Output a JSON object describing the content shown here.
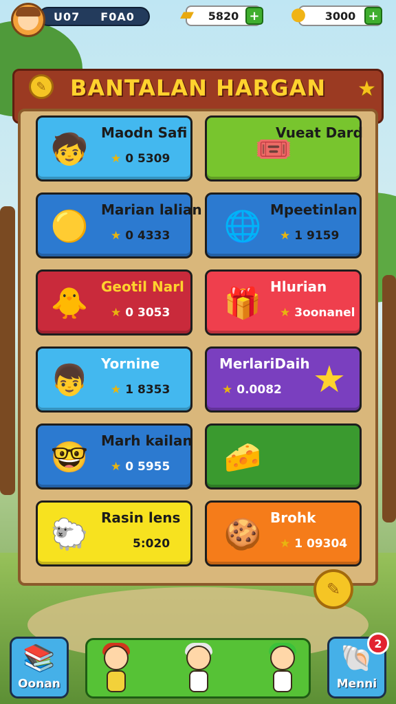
{
  "topbar": {
    "player_name": "U07",
    "player_id": "F0A0",
    "gold_bars": "5820",
    "coins": "3000",
    "plus_label": "+"
  },
  "board": {
    "title": "BANTALAN HARGAN",
    "cards": [
      {
        "name": "Maodn Safi",
        "amount": "0 5309",
        "color": "#43b8ef",
        "icon": "boy-face-icon"
      },
      {
        "name": "Vueat Dard",
        "amount": "",
        "color": "#78c52e",
        "icon": "crossed-tickets-icon"
      },
      {
        "name": "Marian lalian",
        "amount": "0 4333",
        "color": "#2c7ad0",
        "icon": "yellow-blob-icon"
      },
      {
        "name": "Mpeetinlan",
        "amount": "1 9159",
        "color": "#2c7ad0",
        "icon": "globe-ticket-icon"
      },
      {
        "name": "Geotil Narl",
        "amount": "0 3053",
        "color": "#c92a3b",
        "icon": "yellow-chick-icon"
      },
      {
        "name": "Hlurian",
        "amount": "3oonanel",
        "color": "#ef3f4d",
        "icon": "gift-box-icon"
      },
      {
        "name": "Yornine",
        "amount": "1 8353",
        "color": "#43b8ef",
        "icon": "smiling-boy-icon"
      },
      {
        "name": "MerlariDaih",
        "amount": "0.0082",
        "color": "#7a3fbf",
        "icon": "star-face-icon"
      },
      {
        "name": "Marh kailan",
        "amount": "0 5955",
        "color": "#2c7ad0",
        "icon": "glasses-boy-icon"
      },
      {
        "name": "",
        "amount": "",
        "color": "#3a9a2f",
        "icon": "cheese-icon"
      },
      {
        "name": "Rasin lens",
        "amount": "5:020",
        "color": "#f7e21f",
        "icon": "sheep-icon"
      },
      {
        "name": "Brohk",
        "amount": "1 09304",
        "color": "#f57c1a",
        "icon": "cookie-creature-icon"
      }
    ]
  },
  "bottombar": {
    "left_label": "Oonan",
    "right_label": "Menni",
    "notification_count": "2"
  }
}
